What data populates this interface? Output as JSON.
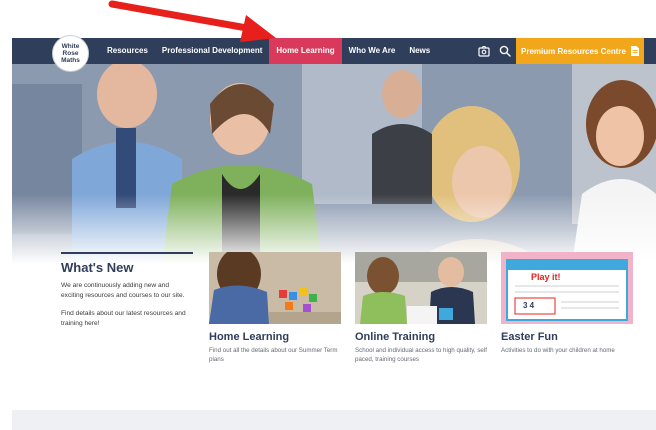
{
  "logo": {
    "line1": "White",
    "line2": "Rose",
    "line3": "Maths"
  },
  "nav": {
    "items": [
      {
        "label": "Resources",
        "active": false
      },
      {
        "label": "Professional Development",
        "active": false
      },
      {
        "label": "Home Learning",
        "active": true
      },
      {
        "label": "Who We Are",
        "active": false
      },
      {
        "label": "News",
        "active": false
      }
    ],
    "account_icon": "account-icon",
    "search_icon": "search-icon",
    "premium_label": "Premium Resources Centre",
    "premium_icon": "document-icon"
  },
  "whats_new": {
    "title": "What's New",
    "para1": "We are continuously adding new and exciting resources and courses to our site.",
    "para2": "Find details about our latest resources and training here!"
  },
  "cards": [
    {
      "title": "Home Learning",
      "desc": "Find out all the details about our Summer Term plans"
    },
    {
      "title": "Online Training",
      "desc": "School and individual access to high quality, self paced, training courses"
    },
    {
      "title": "Easter Fun",
      "desc": "Activities to do with your children at home"
    }
  ],
  "easter_card_image": {
    "heading": "Play it!",
    "number": "3 4"
  },
  "colors": {
    "nav": "#2f3e5b",
    "active": "#d93a5b",
    "premium": "#f2a71b",
    "arrow": "#e8201c"
  }
}
